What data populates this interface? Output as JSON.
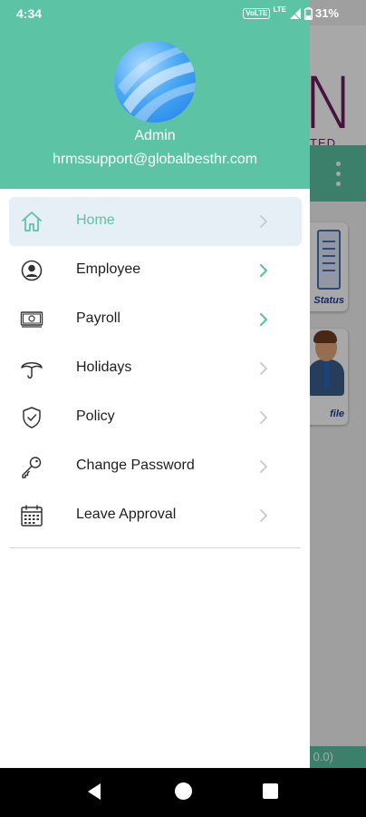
{
  "status_bar": {
    "time": "4:34",
    "volte": "VoLTE",
    "lte": "LTE",
    "battery": "31%"
  },
  "background_app": {
    "logo_letter": "N",
    "logo_sub": "TED",
    "card_1_label": "Status",
    "card_2_label": "file",
    "footer_text": "0.0)"
  },
  "drawer": {
    "user_name": "Admin",
    "user_email": "hrmssupport@globalbesthr.com",
    "menu": [
      {
        "label": "Home",
        "icon": "home-icon",
        "active": true
      },
      {
        "label": "Employee",
        "icon": "user-circle-icon",
        "active": false
      },
      {
        "label": "Payroll",
        "icon": "money-icon",
        "active": false
      },
      {
        "label": "Holidays",
        "icon": "umbrella-icon",
        "active": false
      },
      {
        "label": "Policy",
        "icon": "shield-check-icon",
        "active": false
      },
      {
        "label": "Change Password",
        "icon": "key-icon",
        "active": false
      },
      {
        "label": "Leave Approval",
        "icon": "calendar-icon",
        "active": false
      }
    ]
  },
  "colors": {
    "accent": "#5cc3a5",
    "active_bg": "#e6eef6",
    "text": "#1e1e1e",
    "chevron_inactive": "#c8c8c8"
  }
}
